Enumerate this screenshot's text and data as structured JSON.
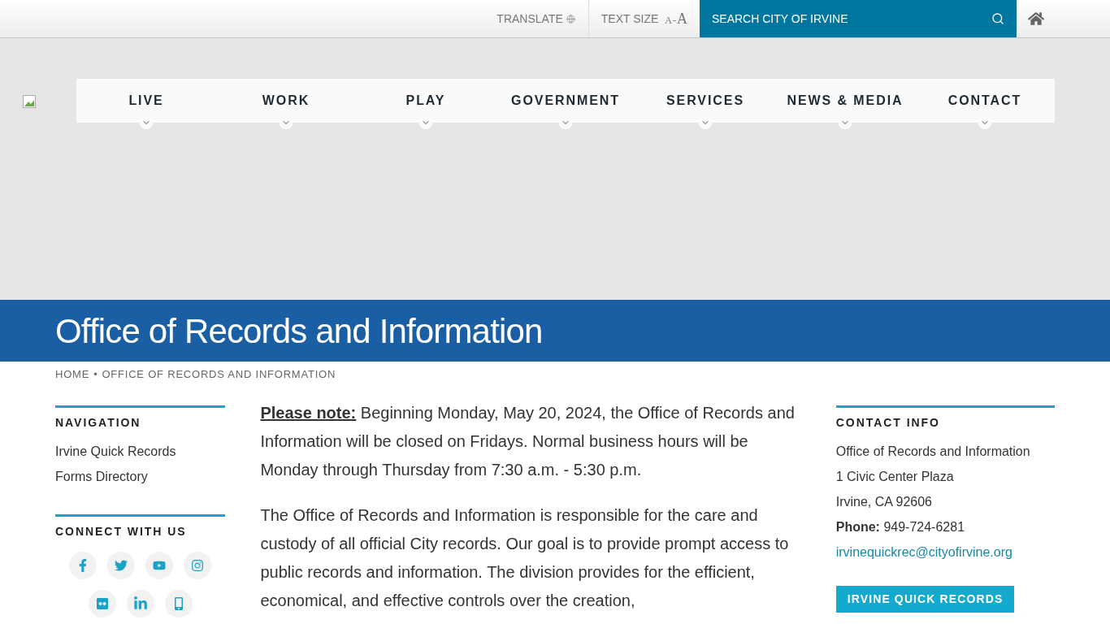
{
  "utility_bar": {
    "translate": "TRANSLATE",
    "text_size": {
      "label": "TEXT SIZE",
      "small": "A",
      "separator": "-",
      "large": "A"
    },
    "search": {
      "placeholder": "SEARCH CITY OF IRVINE"
    }
  },
  "nav": [
    "LIVE",
    "WORK",
    "PLAY",
    "GOVERNMENT",
    "SERVICES",
    "NEWS & MEDIA",
    "CONTACT"
  ],
  "page_title": "Office of Records and Information",
  "breadcrumb": [
    "HOME",
    "•",
    "OFFICE OF RECORDS AND INFORMATION"
  ],
  "sidebar": {
    "navigation": {
      "title": "NAVIGATION",
      "links": [
        "Irvine Quick Records",
        "Forms Directory"
      ]
    },
    "connect": {
      "title": "CONNECT WITH US"
    }
  },
  "main": {
    "paragraphs": [
      "**Please note:** Beginning Monday, May 20, 2024, the Office of Records and Information will be closed on Fridays. Normal business hours will be Monday through Thursday from 7:30 a.m. - 5:30 p.m.",
      "The Office of Records and Information is responsible for the care and custody of all official City records. Our goal is to provide prompt access to public records and information. The division provides for the efficient, economical, and effective controls over the creation,"
    ]
  },
  "contact_info": {
    "title": "CONTACT INFO",
    "lines": [
      "Office of Records and Information",
      "1 Civic Center Plaza",
      "Irvine, CA 92606",
      "**Phone:** 949-724-6281"
    ],
    "email": "irvinequickrec@cityofirvine.org",
    "button": "IRVINE QUICK RECORDS"
  }
}
